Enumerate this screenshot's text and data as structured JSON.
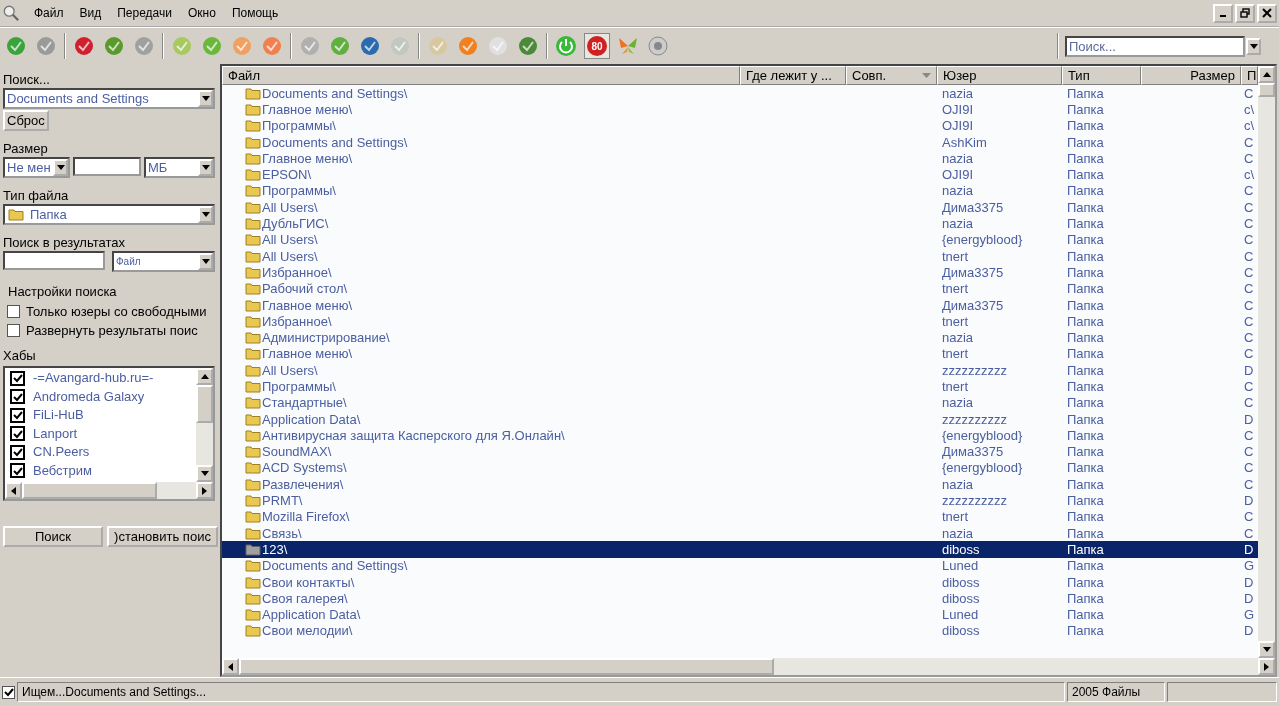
{
  "menu": [
    "Файл",
    "Вид",
    "Передачи",
    "Окно",
    "Помощь"
  ],
  "toolbar": {
    "badge": {
      "text": "80",
      "pressed": true
    },
    "search": {
      "placeholder": "Поиск..."
    }
  },
  "sidebar": {
    "search_label": "Поиск...",
    "search_value": "Documents and Settings",
    "reset": "Сброс",
    "size_label": "Размер",
    "size_mode": "Не мен",
    "size_unit": "МБ",
    "type_label": "Тип файла",
    "type_value": "Папка",
    "within_label": "Поиск в результатах",
    "within_column": "Файл",
    "options_label": "Настройки поиска",
    "options": [
      {
        "label": "Только юзеры со свободными",
        "checked": false
      },
      {
        "label": "Развернуть результаты поис",
        "checked": false
      }
    ],
    "hubs_label": "Хабы",
    "hubs": [
      {
        "name": "-=Avangard-hub.ru=-",
        "checked": true
      },
      {
        "name": "Andromeda Galaxy",
        "checked": true
      },
      {
        "name": "FiLi-HuB",
        "checked": true
      },
      {
        "name": "Lanport",
        "checked": true
      },
      {
        "name": "CN.Peers",
        "checked": true
      },
      {
        "name": "Вебстрим",
        "checked": true
      }
    ],
    "search_button": "Поиск",
    "stop_button": ")становить поис"
  },
  "table": {
    "columns": [
      "Файл",
      "Где лежит у ...",
      "Совп.",
      "Юзер",
      "Тип",
      "Размер",
      "П"
    ],
    "rows": [
      {
        "file": "Documents and Settings\\",
        "user": "nazia",
        "type": "Папка",
        "path": "C",
        "selected": false
      },
      {
        "file": "Главное меню\\",
        "user": "OJI9I",
        "type": "Папка",
        "path": "c\\",
        "selected": false
      },
      {
        "file": "Программы\\",
        "user": "OJI9I",
        "type": "Папка",
        "path": "c\\",
        "selected": false
      },
      {
        "file": "Documents and Settings\\",
        "user": "AshKim",
        "type": "Папка",
        "path": "C",
        "selected": false
      },
      {
        "file": "Главное меню\\",
        "user": "nazia",
        "type": "Папка",
        "path": "C",
        "selected": false
      },
      {
        "file": "EPSON\\",
        "user": "OJI9I",
        "type": "Папка",
        "path": "c\\",
        "selected": false
      },
      {
        "file": "Программы\\",
        "user": "nazia",
        "type": "Папка",
        "path": "C",
        "selected": false
      },
      {
        "file": "All Users\\",
        "user": "Дима3375",
        "type": "Папка",
        "path": "C",
        "selected": false
      },
      {
        "file": "ДубльГИС\\",
        "user": "nazia",
        "type": "Папка",
        "path": "C",
        "selected": false
      },
      {
        "file": "All Users\\",
        "user": "{energyblood}",
        "type": "Папка",
        "path": "C",
        "selected": false
      },
      {
        "file": "All Users\\",
        "user": "tnert",
        "type": "Папка",
        "path": "C",
        "selected": false
      },
      {
        "file": "Избранное\\",
        "user": "Дима3375",
        "type": "Папка",
        "path": "C",
        "selected": false
      },
      {
        "file": "Рабочий стол\\",
        "user": "tnert",
        "type": "Папка",
        "path": "C",
        "selected": false
      },
      {
        "file": "Главное меню\\",
        "user": "Дима3375",
        "type": "Папка",
        "path": "C",
        "selected": false
      },
      {
        "file": "Избранное\\",
        "user": "tnert",
        "type": "Папка",
        "path": "C",
        "selected": false
      },
      {
        "file": "Администрирование\\",
        "user": "nazia",
        "type": "Папка",
        "path": "C",
        "selected": false
      },
      {
        "file": "Главное меню\\",
        "user": "tnert",
        "type": "Папка",
        "path": "C",
        "selected": false
      },
      {
        "file": "All Users\\",
        "user": "zzzzzzzzzz",
        "type": "Папка",
        "path": "D",
        "selected": false
      },
      {
        "file": "Программы\\",
        "user": "tnert",
        "type": "Папка",
        "path": "C",
        "selected": false
      },
      {
        "file": "Стандартные\\",
        "user": "nazia",
        "type": "Папка",
        "path": "C",
        "selected": false
      },
      {
        "file": "Application Data\\",
        "user": "zzzzzzzzzz",
        "type": "Папка",
        "path": "D",
        "selected": false
      },
      {
        "file": "Антивирусная защита Касперского для Я.Онлайн\\",
        "user": "{energyblood}",
        "type": "Папка",
        "path": "C",
        "selected": false
      },
      {
        "file": "SoundMAX\\",
        "user": "Дима3375",
        "type": "Папка",
        "path": "C",
        "selected": false
      },
      {
        "file": "ACD Systems\\",
        "user": "{energyblood}",
        "type": "Папка",
        "path": "C",
        "selected": false
      },
      {
        "file": "Развлечения\\",
        "user": "nazia",
        "type": "Папка",
        "path": "C",
        "selected": false
      },
      {
        "file": "PRMT\\",
        "user": "zzzzzzzzzz",
        "type": "Папка",
        "path": "D",
        "selected": false
      },
      {
        "file": "Mozilla Firefox\\",
        "user": "tnert",
        "type": "Папка",
        "path": "C",
        "selected": false
      },
      {
        "file": "Связь\\",
        "user": "nazia",
        "type": "Папка",
        "path": "C",
        "selected": false
      },
      {
        "file": "123\\",
        "user": "diboss",
        "type": "Папка",
        "path": "D",
        "selected": true
      },
      {
        "file": "Documents and Settings\\",
        "user": "Luned",
        "type": "Папка",
        "path": "G",
        "selected": false
      },
      {
        "file": "Свои контакты\\",
        "user": "diboss",
        "type": "Папка",
        "path": "D",
        "selected": false
      },
      {
        "file": "Своя галерея\\",
        "user": "diboss",
        "type": "Папка",
        "path": "D",
        "selected": false
      },
      {
        "file": "Application Data\\",
        "user": "Luned",
        "type": "Папка",
        "path": "G",
        "selected": false
      },
      {
        "file": "Свои мелодии\\",
        "user": "diboss",
        "type": "Папка",
        "path": "D",
        "selected": false
      }
    ]
  },
  "status_bar": {
    "checked": true,
    "message": "Ищем...Documents and Settings...",
    "count": "2005 Файлы"
  }
}
